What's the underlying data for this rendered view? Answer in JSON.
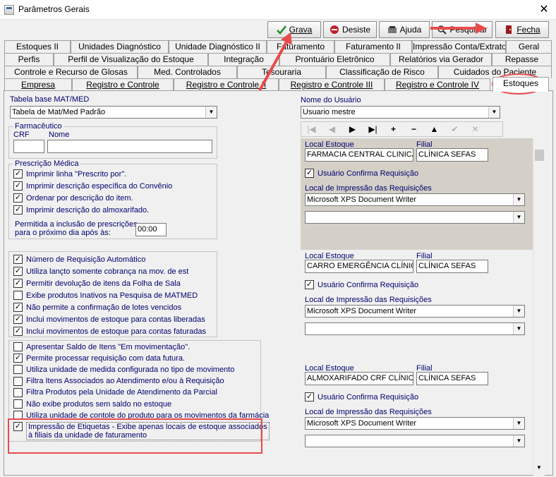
{
  "window": {
    "title": "Parâmetros Gerais",
    "close_glyph": "✕"
  },
  "toolbar": {
    "grava": "Grava",
    "desiste": "Desiste",
    "ajuda": "Ajuda",
    "pesquisar": "Pesquisar",
    "fecha": "Fecha"
  },
  "tabs": {
    "row1": [
      "Estoques II",
      "Unidades Diagnóstico",
      "Unidade Diagnóstico II",
      "Faturamento",
      "Faturamento II",
      "Impressão Conta/Extrato",
      "Geral"
    ],
    "row2": [
      "Perfis",
      "Perfil de Visualização do Estoque",
      "Integração",
      "Prontuário Eletrônico",
      "Relatórios via Gerador",
      "Repasse"
    ],
    "row3": [
      "Controle e Recurso de Glosas",
      "Med. Controlados",
      "Tesouraria",
      "Classificação de Risco",
      "Cuidados do Paciente"
    ],
    "row4": [
      "Empresa",
      "Registro e Controle",
      "Registro e Controle II",
      "Registro e Controle III",
      "Registro e Controle IV",
      "Estoques"
    ]
  },
  "left": {
    "tabela_label": "Tabela base MAT/MED",
    "tabela_value": "Tabela de Mat/Med Padrão",
    "farmaceutico": {
      "title": "Farmacêutico",
      "crf_label": "CRF",
      "nome_label": "Nome",
      "crf_value": "",
      "nome_value": ""
    },
    "prescricao": {
      "title": "Prescrição Médica",
      "items": [
        "Imprimir linha \"Prescrito por\".",
        "Imprimir descrição específica do Convênio",
        "Ordenar por descrição do item.",
        "Imprimir descrição do almoxarifado."
      ],
      "checked": [
        true,
        true,
        true,
        true
      ],
      "permitida_l1": "Permitida a inclusão de prescrições",
      "permitida_l2": "para o próximo dia após às:",
      "hora": "00:00"
    },
    "group2": {
      "items": [
        "Número de Requisição Automático",
        "Utiliza lançto somente cobrança na mov. de est",
        "Permitir devolução de itens da Folha de Sala",
        "Exibe produtos Inativos na Pesquisa de MATMED",
        "Não permite a confirmação de lotes vencidos",
        "Inclui movimentos de estoque para contas liberadas",
        "Inclui movimentos de estoque para contas faturadas"
      ],
      "checked": [
        true,
        true,
        true,
        false,
        true,
        true,
        true
      ]
    },
    "group3": {
      "items": [
        "Apresentar Saldo de Itens \"Em movimentação\".",
        "Permite processar requisição com data futura.",
        "Utiliza unidade de medida configurada no tipo de movimento",
        "Filtra Itens Associados ao Atendimento e/ou à Requisição",
        "Filtra Produtos pela Unidade de Atendimento da Parcial",
        "Não exibe produtos sem saldo no estoque",
        "Utiliza unidade de contole do produto para os movimentos da farmácia"
      ],
      "checked": [
        false,
        true,
        false,
        false,
        false,
        false,
        false
      ]
    },
    "etiquetas": {
      "line1": "Impressão de Etiquetas - Exibe apenas locais de estoque associados",
      "line2": "à filiais da unidade de faturamento",
      "checked": true
    }
  },
  "right": {
    "usuario_label": "Nome do Usuário",
    "usuario_value": "Usuario mestre",
    "nav": [
      "|◀",
      "◀",
      "▶",
      "▶|",
      "+",
      "−",
      "▲",
      "✔",
      "✕"
    ],
    "blocks": [
      {
        "local_label": "Local Estoque",
        "filial_label": "Filial",
        "local": "FARMACIA CENTRAL CLINICA",
        "filial": "CLÍNICA SEFAS",
        "confirma": "Usuário Confirma Requisição",
        "impressao_label": "Local de Impressão das Requisições",
        "impressora1": "Microsoft XPS Document Writer",
        "impressora2": ""
      },
      {
        "local_label": "Local Estoque",
        "filial_label": "Filial",
        "local": "CARRO EMERGÊNCIA CLÍNICA",
        "filial": "CLÍNICA SEFAS",
        "confirma": "Usuário Confirma Requisição",
        "impressao_label": "Local de Impressão das Requisições",
        "impressora1": "Microsoft XPS Document Writer",
        "impressora2": ""
      },
      {
        "local_label": "Local Estoque",
        "filial_label": "Filial",
        "local": "ALMOXARIFADO CRF CLÍNICA",
        "filial": "CLÍNICA SEFAS",
        "confirma": "Usuário Confirma Requisição",
        "impressao_label": "Local de Impressão das Requisições",
        "impressora1": "Microsoft XPS Document Writer",
        "impressora2": ""
      }
    ]
  },
  "colors": {
    "highlight": "#e84b4b",
    "label": "#00006e",
    "selected_block": "#d4d0c8"
  }
}
